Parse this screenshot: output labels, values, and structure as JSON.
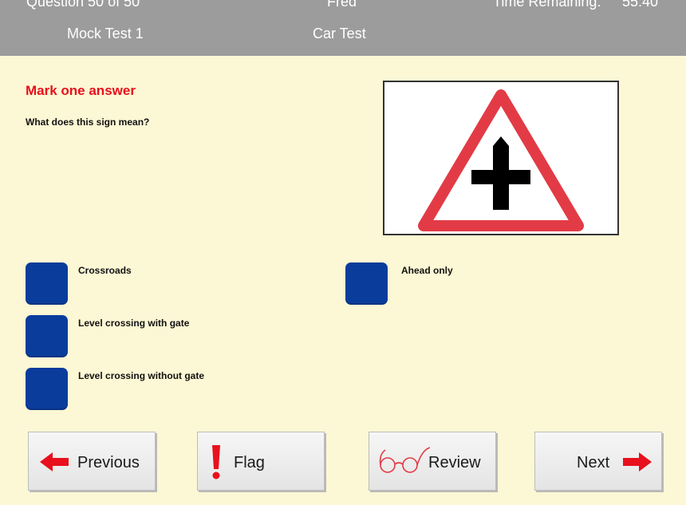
{
  "header": {
    "question_counter": "Question 50 of 50",
    "candidate_name": "Fred",
    "time_remaining_label": "Time Remaining:",
    "time_remaining_value": "55:40",
    "test_name": "Mock Test 1",
    "test_type": "Car Test"
  },
  "question": {
    "instruction": "Mark one answer",
    "text": "What does this sign mean?",
    "sign_icon": "crossroads-warning-sign"
  },
  "answers": [
    {
      "label": "Crossroads"
    },
    {
      "label": "Level crossing with gate"
    },
    {
      "label": "Level crossing without gate"
    },
    {
      "label": "Ahead only"
    }
  ],
  "nav": {
    "previous_label": "Previous",
    "flag_label": "Flag",
    "review_label": "Review",
    "next_label": "Next"
  },
  "colors": {
    "background": "#fcf7d4",
    "header": "#9c9c9c",
    "answer_box": "#0a3c9c",
    "accent_red": "#e8101c"
  }
}
